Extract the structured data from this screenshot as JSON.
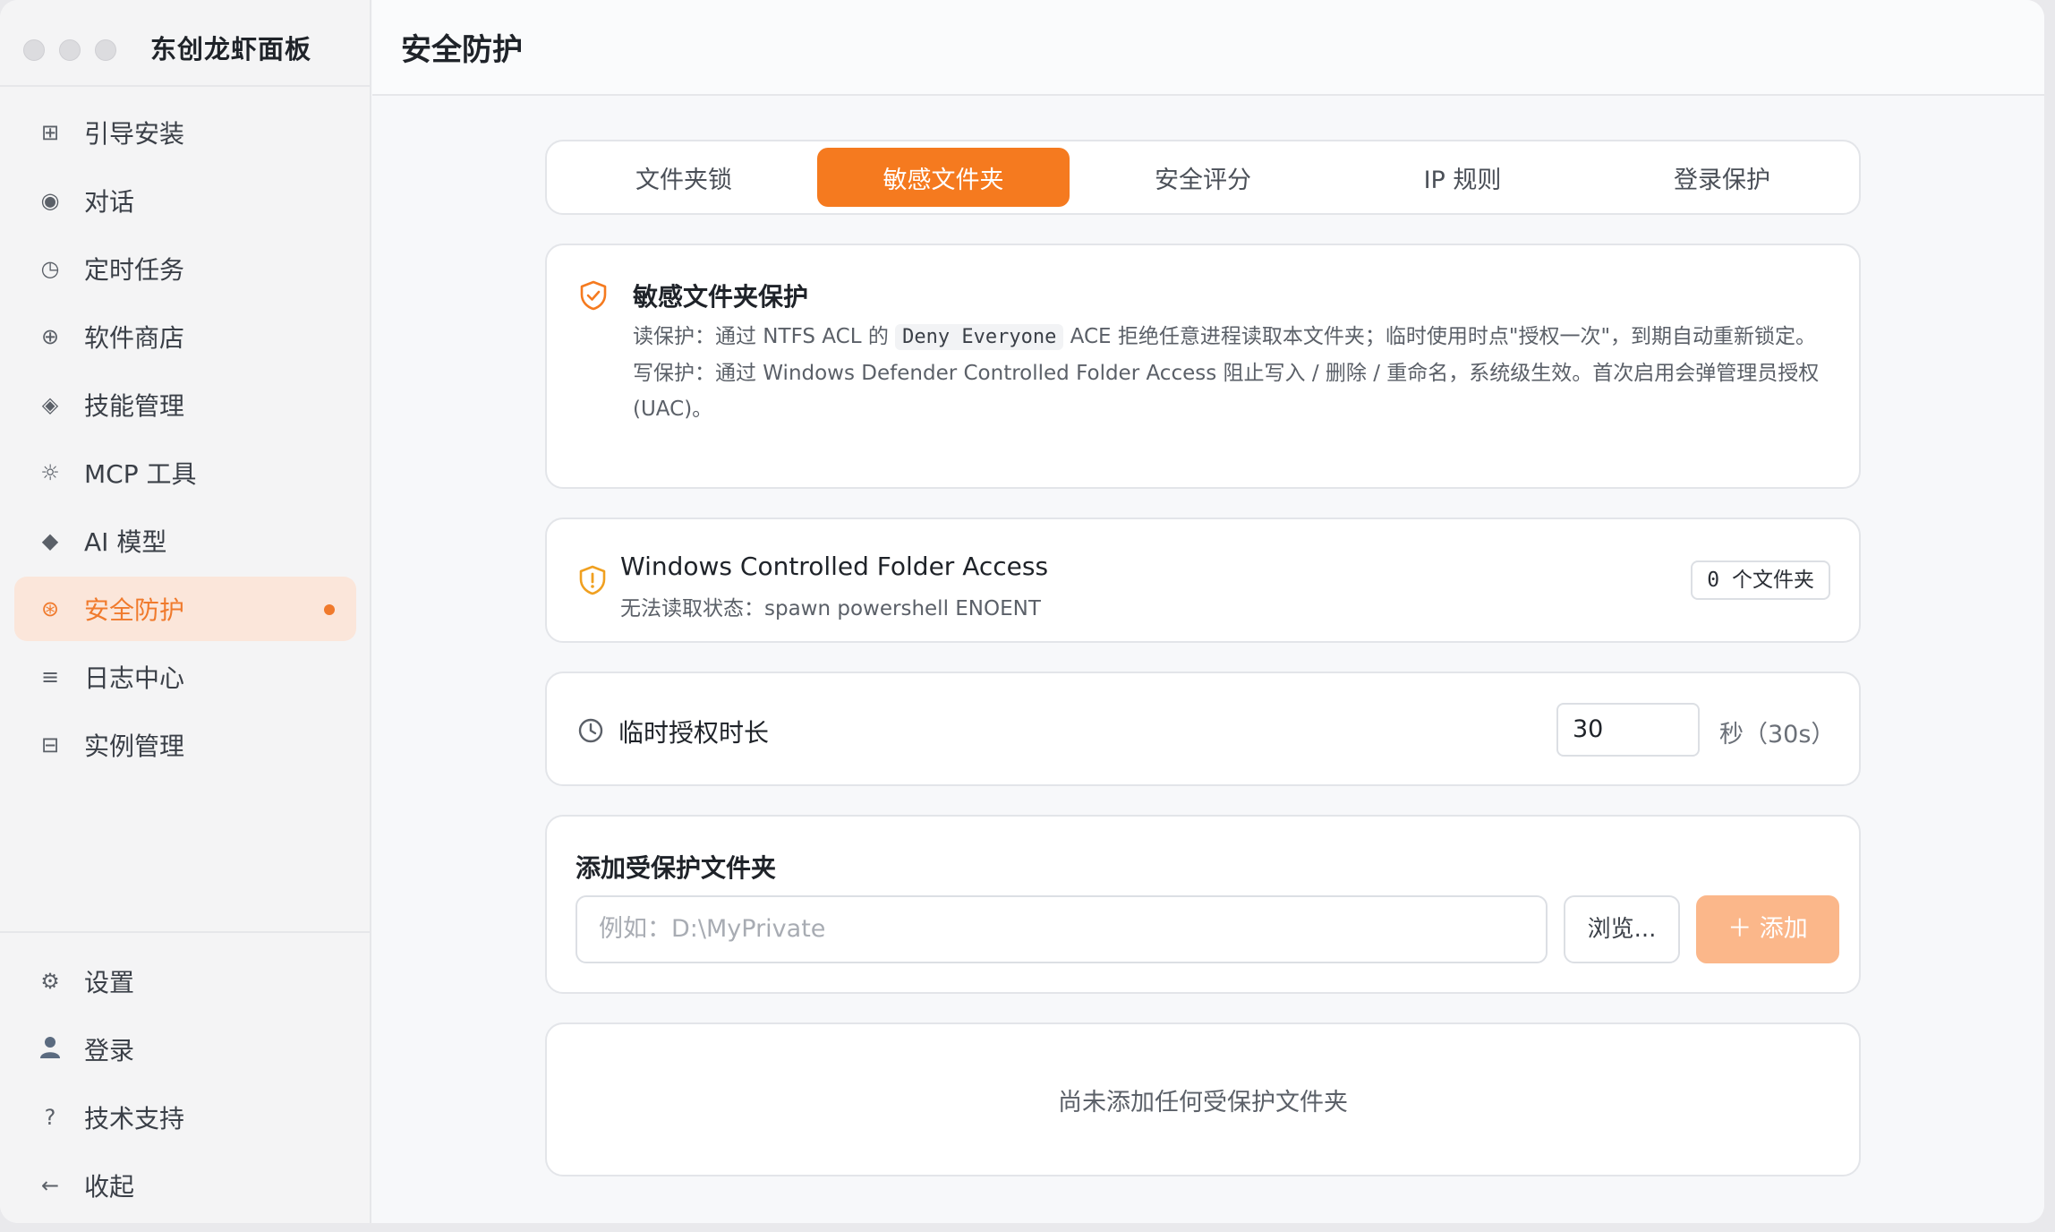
{
  "app": {
    "title": "东创龙虾面板"
  },
  "sidebar": {
    "items": [
      {
        "label": "引导安装",
        "icon": "grid-icon"
      },
      {
        "label": "对话",
        "icon": "chat-icon"
      },
      {
        "label": "定时任务",
        "icon": "clock-icon"
      },
      {
        "label": "软件商店",
        "icon": "store-icon"
      },
      {
        "label": "技能管理",
        "icon": "skill-icon"
      },
      {
        "label": "MCP 工具",
        "icon": "tool-icon"
      },
      {
        "label": "AI 模型",
        "icon": "diamond-icon"
      },
      {
        "label": "安全防护",
        "icon": "shield-icon",
        "active": true
      },
      {
        "label": "日志中心",
        "icon": "log-icon"
      },
      {
        "label": "实例管理",
        "icon": "instance-icon"
      }
    ],
    "bottom": [
      {
        "label": "设置",
        "icon": "gear-icon"
      },
      {
        "label": "登录",
        "icon": "user-icon"
      },
      {
        "label": "技术支持",
        "icon": "help-icon"
      },
      {
        "label": "收起",
        "icon": "arrow-left-icon"
      }
    ]
  },
  "header": {
    "title": "安全防护"
  },
  "tabs": [
    "文件夹锁",
    "敏感文件夹",
    "安全评分",
    "IP 规则",
    "登录保护"
  ],
  "info": {
    "title": "敏感文件夹保护",
    "read_prefix": "读保护：通过 NTFS ACL 的",
    "read_code": "Deny Everyone",
    "read_suffix": "ACE 拒绝任意进程读取本文件夹；临时使用时点\"授权一次\"，到期自动重新锁定。",
    "write": "写保护：通过 Windows Defender Controlled Folder Access 阻止写入 / 删除 / 重命名，系统级生效。首次启用会弹管理员授权 (UAC)。"
  },
  "cfa": {
    "title": "Windows Controlled Folder Access",
    "status": "无法读取状态：spawn powershell ENOENT",
    "badge": "0 个文件夹"
  },
  "duration": {
    "label": "临时授权时长",
    "value": "30",
    "unit": "秒（30s）"
  },
  "add": {
    "title": "添加受保护文件夹",
    "placeholder": "例如：D:\\MyPrivate",
    "browse": "浏览...",
    "add": "＋ 添加"
  },
  "empty": {
    "text": "尚未添加任何受保护文件夹"
  },
  "colors": {
    "accent": "#f57a1f",
    "accent_light": "#fbb78a",
    "active_bg": "#fbe6da"
  }
}
